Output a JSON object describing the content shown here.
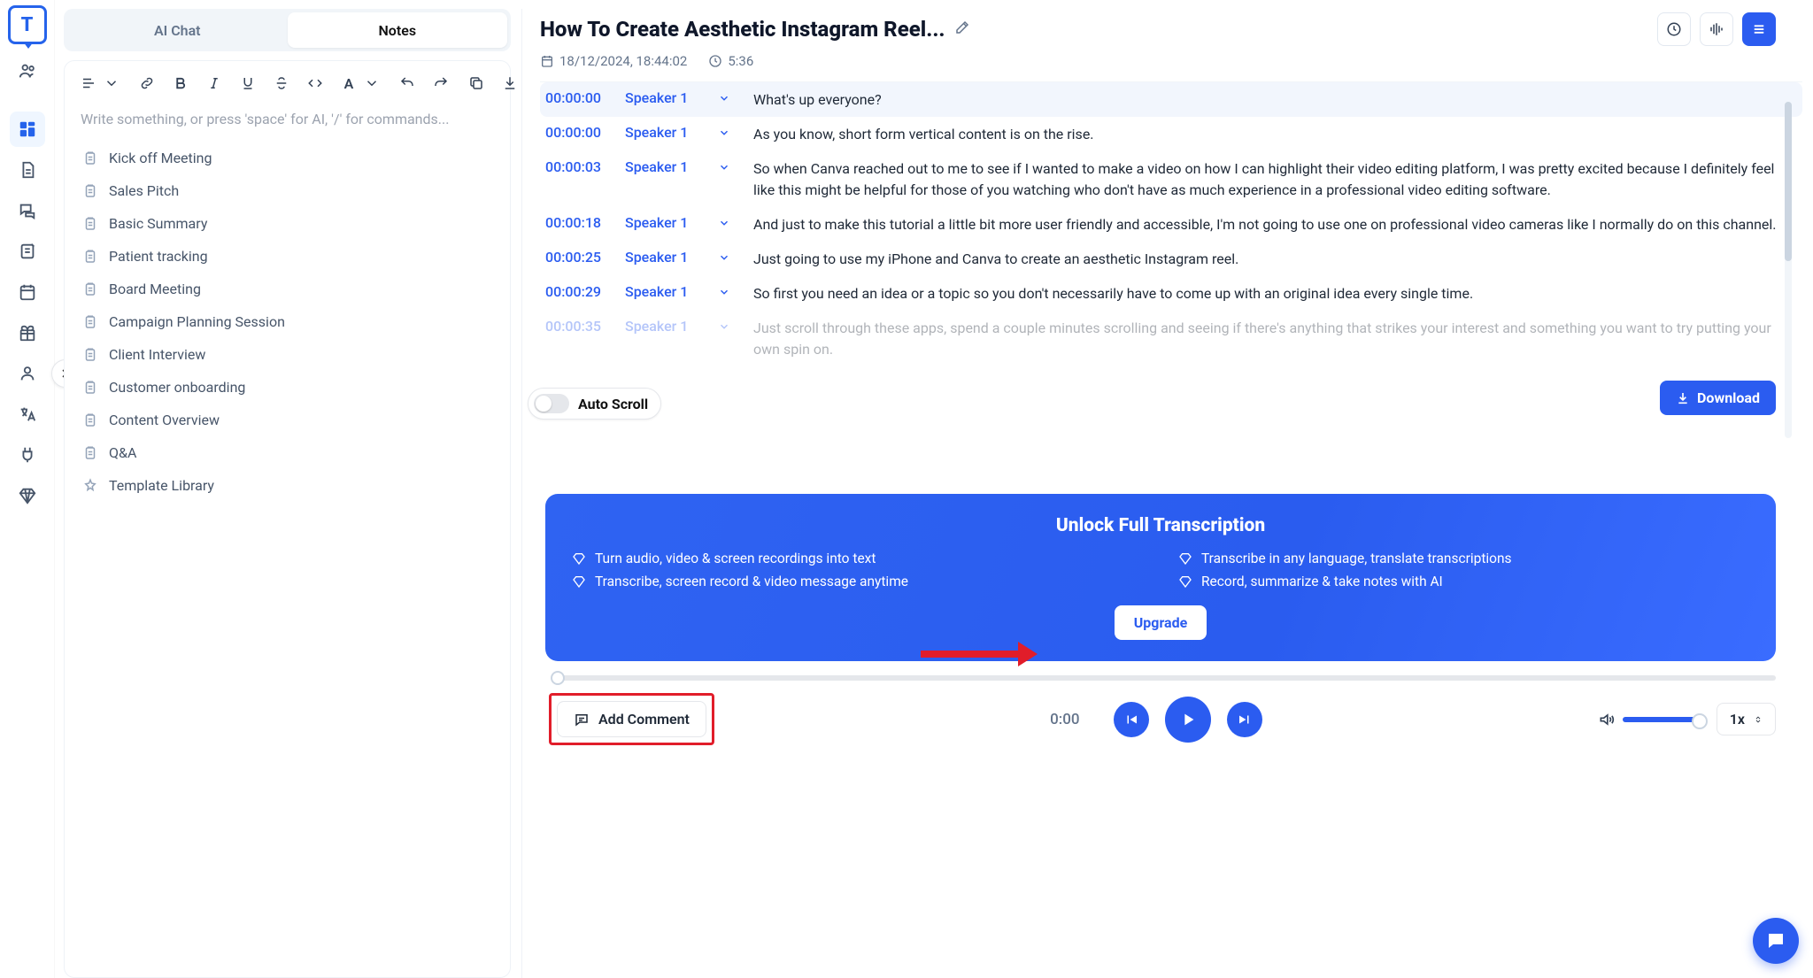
{
  "app": {
    "logo_letter": "T"
  },
  "rail": {
    "items": [
      "grid",
      "doc",
      "chat",
      "tasks",
      "calendar",
      "gift",
      "user",
      "lang",
      "plug",
      "diamond"
    ]
  },
  "tabs": {
    "ai_chat": "AI Chat",
    "notes": "Notes"
  },
  "editor": {
    "placeholder": "Write something, or press 'space' for AI, '/' for commands...",
    "templates": [
      "Kick off Meeting",
      "Sales Pitch",
      "Basic Summary",
      "Patient tracking",
      "Board Meeting",
      "Campaign Planning Session",
      "Client Interview",
      "Customer onboarding",
      "Content Overview",
      "Q&A",
      "Template Library"
    ]
  },
  "header": {
    "title": "How To Create Aesthetic Instagram Reel...",
    "date": "18/12/2024, 18:44:02",
    "duration": "5:36"
  },
  "transcript": [
    {
      "ts": "00:00:00",
      "speaker": "Speaker 1",
      "text": "What's up everyone?",
      "active": true
    },
    {
      "ts": "00:00:00",
      "speaker": "Speaker 1",
      "text": "As you know, short form vertical content is on the rise."
    },
    {
      "ts": "00:00:03",
      "speaker": "Speaker 1",
      "text": "So when Canva reached out to me to see if I wanted to make a video on how I can highlight their video editing platform, I was pretty excited because I definitely feel like this might be helpful for those of you watching who don't have as much experience in a professional video editing software."
    },
    {
      "ts": "00:00:18",
      "speaker": "Speaker 1",
      "text": "And just to make this tutorial a little bit more user friendly and accessible, I'm not going to use one on professional video cameras like I normally do on this channel."
    },
    {
      "ts": "00:00:25",
      "speaker": "Speaker 1",
      "text": "Just going to use my iPhone and Canva to create an aesthetic Instagram reel."
    },
    {
      "ts": "00:00:29",
      "speaker": "Speaker 1",
      "text": "So first you need an idea or a topic so you don't necessarily have to come up with an original idea every single time."
    },
    {
      "ts": "00:00:35",
      "speaker": "Speaker 1",
      "text": "Just scroll through these apps, spend a couple minutes scrolling and seeing if there's anything that strikes your interest and something you want to try putting your own spin on.",
      "faded": true
    }
  ],
  "autoscroll_label": "Auto Scroll",
  "download_label": "Download",
  "promo": {
    "title": "Unlock Full Transcription",
    "features": [
      "Turn audio, video & screen recordings into text",
      "Transcribe in any language, translate transcriptions",
      "Transcribe, screen record & video message anytime",
      "Record, summarize & take notes with AI"
    ],
    "cta": "Upgrade"
  },
  "player": {
    "current_time": "0:00",
    "speed": "1x",
    "add_comment": "Add Comment"
  }
}
